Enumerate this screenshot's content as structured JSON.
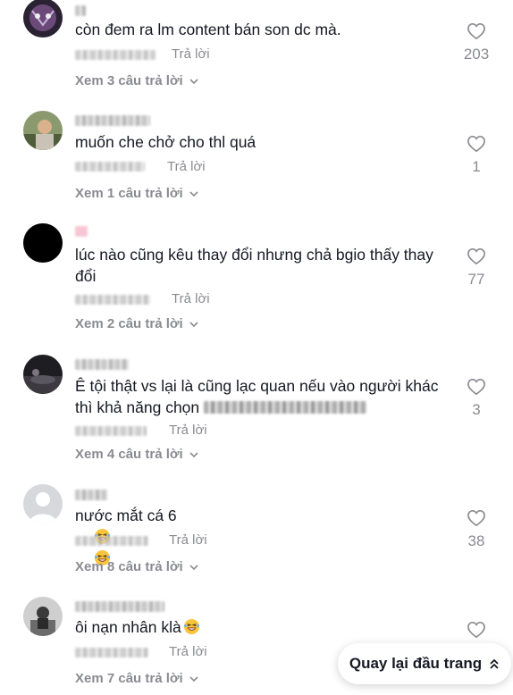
{
  "comments": [
    {
      "text": "còn đem ra lm content bán son dc mà.",
      "likes": "203",
      "reply_label": "Trả lời",
      "view_replies": "Xem 3 câu trả lời"
    },
    {
      "text": "muốn che chở cho thl quá",
      "likes": "1",
      "reply_label": "Trả lời",
      "view_replies": "Xem 1 câu trả lời"
    },
    {
      "text": "lúc nào cũng kêu thay đổi nhưng chả bgio thấy thay\nđổi",
      "likes": "77",
      "reply_label": "Trả lời",
      "view_replies": "Xem 2 câu trả lời"
    },
    {
      "text": "Ê tội thật vs lại là cũng lạc quan nếu vào người khác\nthì khả năng chọn",
      "likes": "3",
      "reply_label": "Trả lời",
      "view_replies": "Xem 4 câu trả lời"
    },
    {
      "text": "nước mắt cá 6",
      "likes": "38",
      "reply_label": "Trả lời",
      "view_replies": "Xem 8 câu trả lời"
    },
    {
      "text": "ôi nạn nhân klà",
      "likes": "",
      "reply_label": "Trả lời",
      "view_replies": "Xem 7 câu trả lời"
    }
  ],
  "back_to_top_label": "Quay lại đầu trang",
  "icons": {
    "like": "heart-outline-icon",
    "expand": "chevron-down-icon",
    "back_to_top": "double-chevron-up-icon",
    "emoji": "grinning-squinting-emoji-icon"
  },
  "colors": {
    "text": "#161823",
    "muted": "#8a8b91",
    "background": "#ffffff"
  }
}
